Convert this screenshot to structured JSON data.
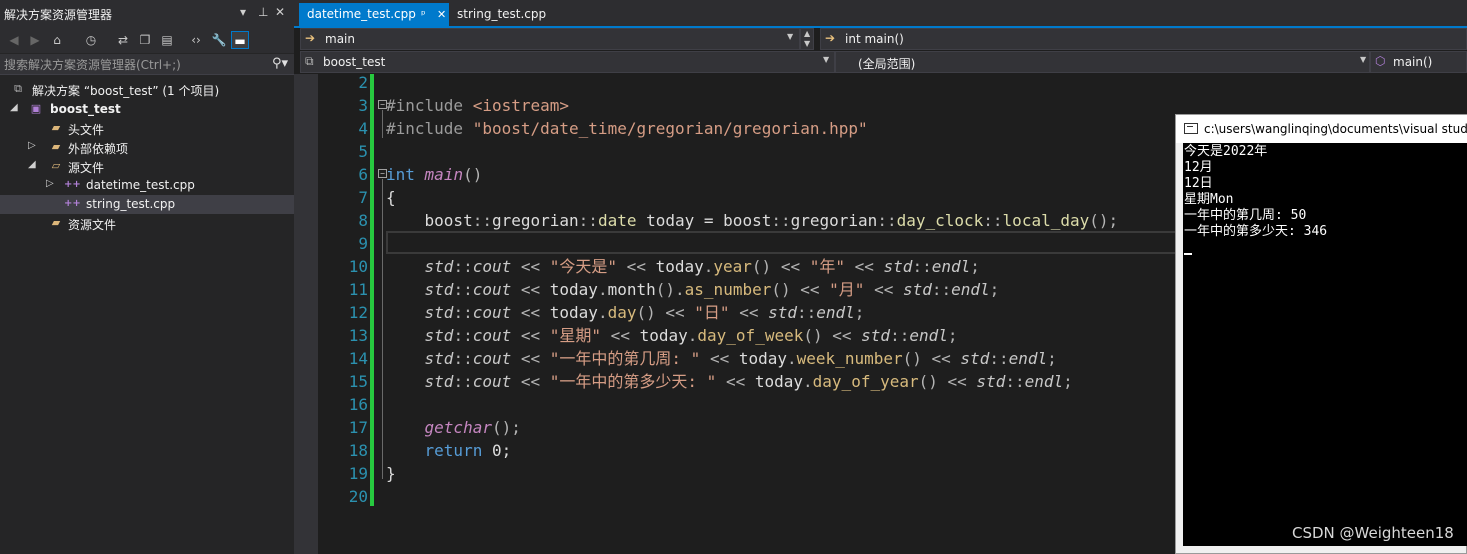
{
  "solution_explorer": {
    "title": "解决方案资源管理器",
    "title_controls": [
      "▾",
      "ᵖ",
      "✕"
    ],
    "search_placeholder": "搜索解决方案资源管理器(Ctrl+;)",
    "tree": {
      "solution": "解决方案 “boost_test” (1 个项目)",
      "project": "boost_test",
      "headers": "头文件",
      "external_deps": "外部依赖项",
      "sources": "源文件",
      "file1": "datetime_test.cpp",
      "file2": "string_test.cpp",
      "resources": "资源文件"
    }
  },
  "tabs": [
    {
      "label": "datetime_test.cpp",
      "active": true
    },
    {
      "label": "string_test.cpp",
      "active": false
    }
  ],
  "nav": {
    "config": "main",
    "function": "int main()",
    "project": "boost_test",
    "scope": "(全局范围)",
    "member": "main()"
  },
  "editor": {
    "line_numbers": [
      "2",
      "3",
      "4",
      "5",
      "6",
      "7",
      "8",
      "9",
      "10",
      "11",
      "12",
      "13",
      "14",
      "15",
      "16",
      "17",
      "18",
      "19",
      "20"
    ],
    "code": {
      "l3_pre": "#include ",
      "l3_str": "<iostream>",
      "l4_pre": "#include ",
      "l4_str": "\"boost/date_time/gregorian/gregorian.hpp\"",
      "kw_int": "int",
      "fn_main": "main",
      "parens": "()",
      "brace_open": "{",
      "brace_close": "}",
      "indent": "    ",
      "boost": "boost",
      "gregorian": "gregorian",
      "sep": "::",
      "date": "date",
      "today_decl": " today = ",
      "day_clock": "day_clock",
      "local_day": "local_day",
      "call_end": "();",
      "std": "std",
      "cout": "cout",
      "shl": " << ",
      "endl": "endl",
      "semi": ";",
      "today": "today",
      "dot": ".",
      "call": "()",
      "s_today_is": "\"今天是\"",
      "year": "year",
      "s_year": "\"年\"",
      "month": "month",
      "as_number": "as_number",
      "s_month": "\"月\"",
      "day": "day",
      "s_day": "\"日\"",
      "s_weekday": "\"星期\"",
      "day_of_week": "day_of_week",
      "s_week_no": "\"一年中的第几周: \"",
      "week_number": "week_number",
      "s_day_no": "\"一年中的第多少天: \"",
      "day_of_year": "day_of_year",
      "getchar": "getchar",
      "kw_return": "return",
      "ret_val": " 0;"
    }
  },
  "console": {
    "title": "c:\\users\\wanglinqing\\documents\\visual studio",
    "lines": [
      "今天是2022年",
      "12月",
      "12日",
      "星期Mon",
      "一年中的第几周: 50",
      "一年中的第多少天: 346"
    ]
  },
  "watermark": "CSDN @Weighteen18",
  "colors": {
    "accent": "#007acc",
    "change_bar": "#27c93f",
    "line_number": "#2b91af",
    "keyword": "#569cd6",
    "string": "#d69d85",
    "function_italic": "#c586c0",
    "type": "#dcdcaa"
  },
  "icons": {
    "back": "back-icon",
    "forward": "forward-icon",
    "home": "home-icon",
    "history": "history-icon",
    "sync": "sync-icon",
    "collapse": "collapse-all-icon",
    "show_all": "show-all-files-icon",
    "code": "view-code-icon",
    "properties": "wrench-icon",
    "preview": "preview-icon",
    "search": "search-icon",
    "pin": "pin-icon",
    "close": "close-icon"
  }
}
